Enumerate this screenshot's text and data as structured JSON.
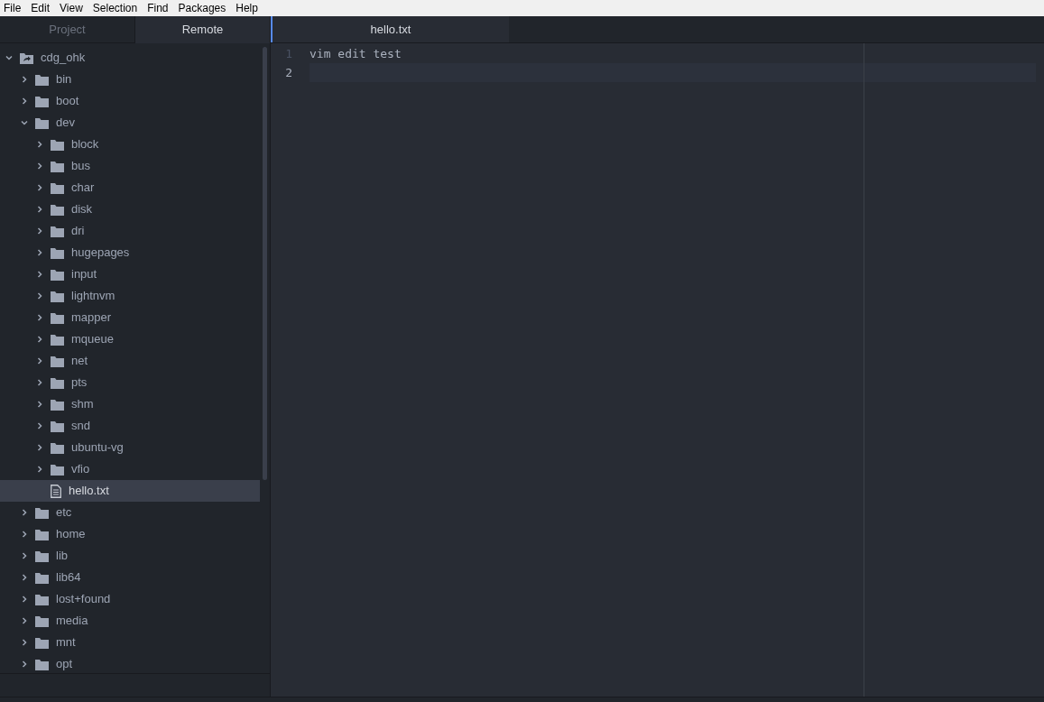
{
  "menu": [
    "File",
    "Edit",
    "View",
    "Selection",
    "Find",
    "Packages",
    "Help"
  ],
  "sidebar_tabs": [
    {
      "label": "Project",
      "selected": false
    },
    {
      "label": "Remote",
      "selected": true
    }
  ],
  "tree": {
    "label": "cdg_ohk",
    "kind": "root",
    "expanded": true,
    "selected": false,
    "children": [
      {
        "label": "bin",
        "kind": "folder",
        "expanded": false,
        "selected": false
      },
      {
        "label": "boot",
        "kind": "folder",
        "expanded": false,
        "selected": false
      },
      {
        "label": "dev",
        "kind": "folder",
        "expanded": true,
        "selected": false,
        "children": [
          {
            "label": "block",
            "kind": "folder",
            "expanded": false,
            "selected": false
          },
          {
            "label": "bus",
            "kind": "folder",
            "expanded": false,
            "selected": false
          },
          {
            "label": "char",
            "kind": "folder",
            "expanded": false,
            "selected": false
          },
          {
            "label": "disk",
            "kind": "folder",
            "expanded": false,
            "selected": false
          },
          {
            "label": "dri",
            "kind": "folder",
            "expanded": false,
            "selected": false
          },
          {
            "label": "hugepages",
            "kind": "folder",
            "expanded": false,
            "selected": false
          },
          {
            "label": "input",
            "kind": "folder",
            "expanded": false,
            "selected": false
          },
          {
            "label": "lightnvm",
            "kind": "folder",
            "expanded": false,
            "selected": false
          },
          {
            "label": "mapper",
            "kind": "folder",
            "expanded": false,
            "selected": false
          },
          {
            "label": "mqueue",
            "kind": "folder",
            "expanded": false,
            "selected": false
          },
          {
            "label": "net",
            "kind": "folder",
            "expanded": false,
            "selected": false
          },
          {
            "label": "pts",
            "kind": "folder",
            "expanded": false,
            "selected": false
          },
          {
            "label": "shm",
            "kind": "folder",
            "expanded": false,
            "selected": false
          },
          {
            "label": "snd",
            "kind": "folder",
            "expanded": false,
            "selected": false
          },
          {
            "label": "ubuntu-vg",
            "kind": "folder",
            "expanded": false,
            "selected": false
          },
          {
            "label": "vfio",
            "kind": "folder",
            "expanded": false,
            "selected": false
          },
          {
            "label": "hello.txt",
            "kind": "file",
            "selected": true
          }
        ]
      },
      {
        "label": "etc",
        "kind": "folder",
        "expanded": false,
        "selected": false
      },
      {
        "label": "home",
        "kind": "folder",
        "expanded": false,
        "selected": false
      },
      {
        "label": "lib",
        "kind": "folder",
        "expanded": false,
        "selected": false
      },
      {
        "label": "lib64",
        "kind": "folder",
        "expanded": false,
        "selected": false
      },
      {
        "label": "lost+found",
        "kind": "folder",
        "expanded": false,
        "selected": false
      },
      {
        "label": "media",
        "kind": "folder",
        "expanded": false,
        "selected": false
      },
      {
        "label": "mnt",
        "kind": "folder",
        "expanded": false,
        "selected": false
      },
      {
        "label": "opt",
        "kind": "folder",
        "expanded": false,
        "selected": false
      }
    ]
  },
  "editor_tabs": [
    {
      "label": "hello.txt",
      "selected": true
    }
  ],
  "editor": {
    "lines": [
      {
        "number": "1",
        "text": "vim edit test",
        "cursor": false
      },
      {
        "number": "2",
        "cursor": true
      }
    ]
  }
}
